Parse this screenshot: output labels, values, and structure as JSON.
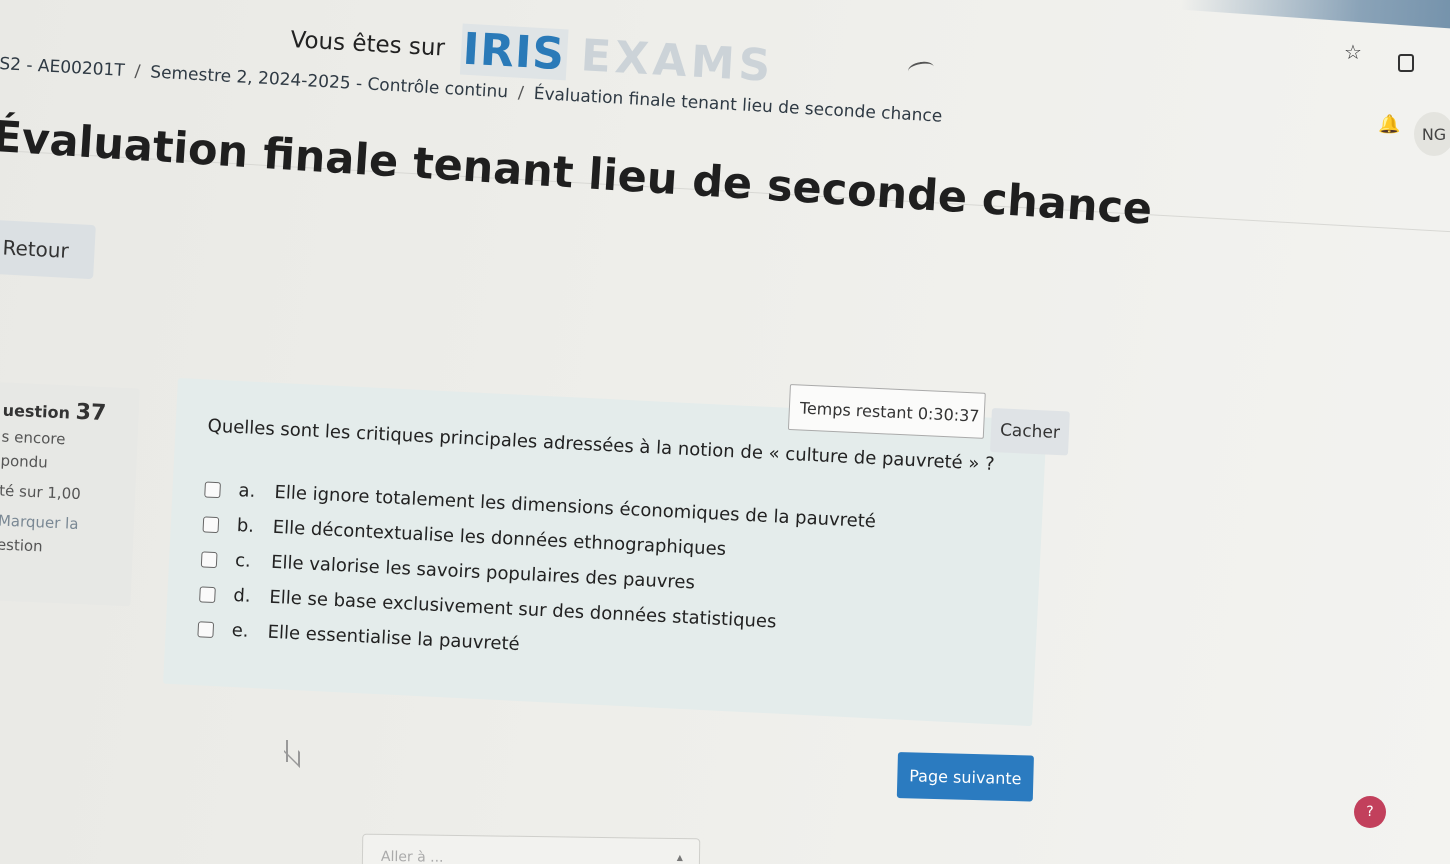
{
  "brand": {
    "prefix": "Vous êtes sur",
    "logo_part1": "IRIS",
    "logo_part2": "EXAMS"
  },
  "breadcrumb": [
    "S2 - AE00201T",
    "Semestre 2, 2024-2025 - Contrôle continu",
    "Évaluation finale tenant lieu de seconde chance"
  ],
  "breadcrumb_separator": "/",
  "page_title": "Évaluation finale tenant lieu de seconde chance",
  "back_button": "Retour",
  "question_info": {
    "number_label": "uestion",
    "number": "37",
    "status_line1": "s encore",
    "status_line2": "pondu",
    "grade": "té sur 1,00",
    "flag_line1": "Marquer la",
    "flag_line2": "estion"
  },
  "question": {
    "text": "Quelles sont les critiques principales adressées à la notion de « culture de pauvreté » ?",
    "answers": [
      {
        "letter": "a.",
        "text": "Elle ignore totalement les dimensions économiques de la pauvreté",
        "checked": false
      },
      {
        "letter": "b.",
        "text": "Elle décontextualise les données ethnographiques",
        "checked": false
      },
      {
        "letter": "c.",
        "text": "Elle valorise les savoirs populaires des pauvres",
        "checked": false
      },
      {
        "letter": "d.",
        "text": "Elle se base exclusivement sur des données statistiques",
        "checked": false
      },
      {
        "letter": "e.",
        "text": "Elle essentialise la pauvreté",
        "checked": false
      }
    ]
  },
  "timer": {
    "label": "Temps restant",
    "value": "0:30:37",
    "hide_button": "Cacher"
  },
  "next_button": "Page suivante",
  "jump_select_placeholder": "Aller à ...",
  "user": {
    "initials": "NG"
  },
  "colors": {
    "accent": "#2b7bc0",
    "logo_blue": "#2a7ab8",
    "question_bg": "#e4eceb",
    "help": "#c2405c"
  },
  "icons": [
    "star-icon",
    "extension-icon",
    "bell-icon",
    "refresh-icon",
    "help-icon",
    "cursor-icon"
  ]
}
